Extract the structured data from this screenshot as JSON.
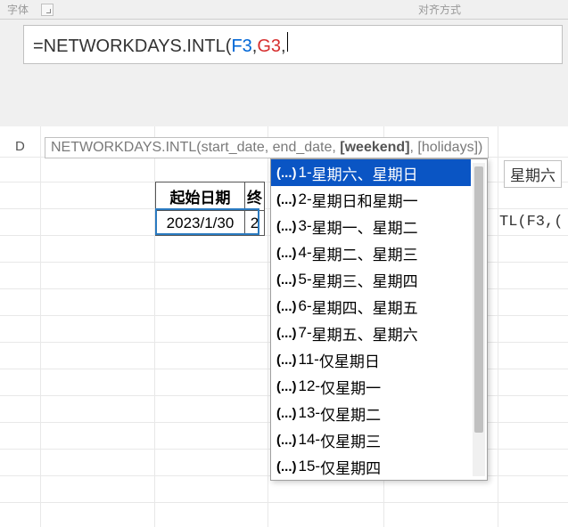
{
  "ribbon": {
    "left_label": "字体",
    "right_label": "对齐方式"
  },
  "formula_bar": {
    "prefix": "=NETWORKDAYS.INTL(",
    "arg1": "F3",
    "sep1": ",",
    "arg2": "G3",
    "suffix": ","
  },
  "column_header": "D",
  "tooltip": {
    "fn": "NETWORKDAYS.INTL(",
    "p1": "start_date, ",
    "p2": "end_date, ",
    "p3_bold": "[weekend]",
    "p4": ", [holidays])"
  },
  "tooltip_right": "星期六",
  "cell_hint_right": "TL(F3,(",
  "table": {
    "header1": "起始日期",
    "header2": "终",
    "row1_col1": "2023/1/30",
    "row1_col2": "2"
  },
  "dropdown": {
    "icon": "(...)",
    "items": [
      {
        "code": "1",
        "label": "星期六、星期日"
      },
      {
        "code": "2",
        "label": "星期日和星期一"
      },
      {
        "code": "3",
        "label": "星期一、星期二"
      },
      {
        "code": "4",
        "label": "星期二、星期三"
      },
      {
        "code": "5",
        "label": "星期三、星期四"
      },
      {
        "code": "6",
        "label": "星期四、星期五"
      },
      {
        "code": "7",
        "label": "星期五、星期六"
      },
      {
        "code": "11",
        "label": "仅星期日"
      },
      {
        "code": "12",
        "label": "仅星期一"
      },
      {
        "code": "13",
        "label": "仅星期二"
      },
      {
        "code": "14",
        "label": "仅星期三"
      },
      {
        "code": "15",
        "label": "仅星期四"
      }
    ]
  }
}
